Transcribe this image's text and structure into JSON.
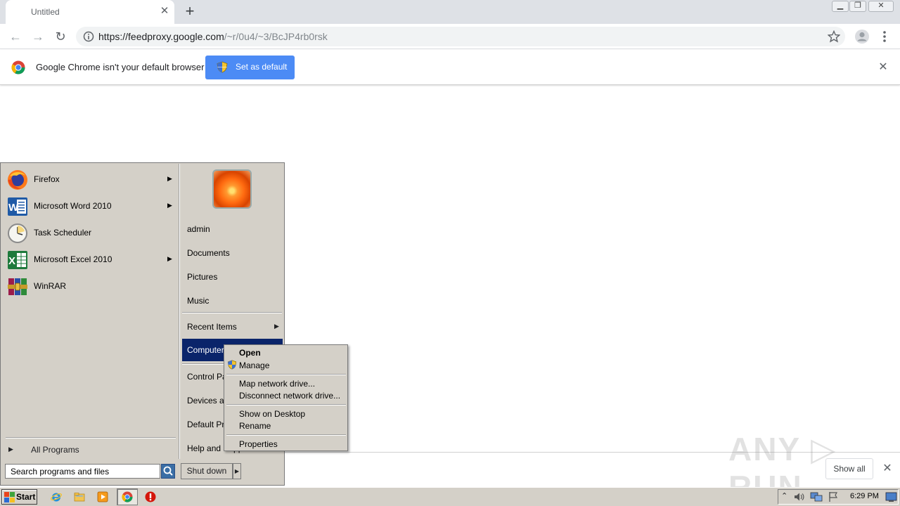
{
  "browser": {
    "tab_title": "Untitled",
    "tab_close": "✕",
    "new_tab": "+",
    "url_host": "https://feedproxy.google.com",
    "url_path": "/~r/0u4/~3/BcJP4rb0rsk"
  },
  "infobar": {
    "message": "Google Chrome isn't your default browser",
    "button_label": "Set as default"
  },
  "downloads": {
    "show_all": "Show all"
  },
  "watermark": "ANY ▷ RUN",
  "start_menu": {
    "programs": [
      {
        "label": "Firefox",
        "icon": "firefox-icon",
        "has_submenu": true
      },
      {
        "label": "Microsoft Word 2010",
        "icon": "word-icon",
        "has_submenu": true
      },
      {
        "label": "Task Scheduler",
        "icon": "task-scheduler-icon",
        "has_submenu": false
      },
      {
        "label": "Microsoft Excel 2010",
        "icon": "excel-icon",
        "has_submenu": true
      },
      {
        "label": "WinRAR",
        "icon": "winrar-icon",
        "has_submenu": false
      }
    ],
    "all_programs": "All Programs",
    "search_placeholder": "Search programs and files",
    "right_items": {
      "admin": "admin",
      "documents": "Documents",
      "pictures": "Pictures",
      "music": "Music",
      "recent": "Recent Items",
      "computer": "Computer",
      "control_panel": "Control Panel",
      "devices": "Devices and Printers",
      "default_programs": "Default Programs",
      "help": "Help and Support"
    },
    "shutdown": "Shut down"
  },
  "context_menu": {
    "open": "Open",
    "manage": "Manage",
    "map_drive": "Map network drive...",
    "disconnect_drive": "Disconnect network drive...",
    "show_desktop": "Show on Desktop",
    "rename": "Rename",
    "properties": "Properties"
  },
  "taskbar": {
    "start": "Start",
    "clock": "6:29 PM"
  },
  "colors": {
    "infobar_button": "#4c8bf5",
    "menu_highlight": "#0a246a",
    "classic_gray": "#d4d0c8"
  }
}
